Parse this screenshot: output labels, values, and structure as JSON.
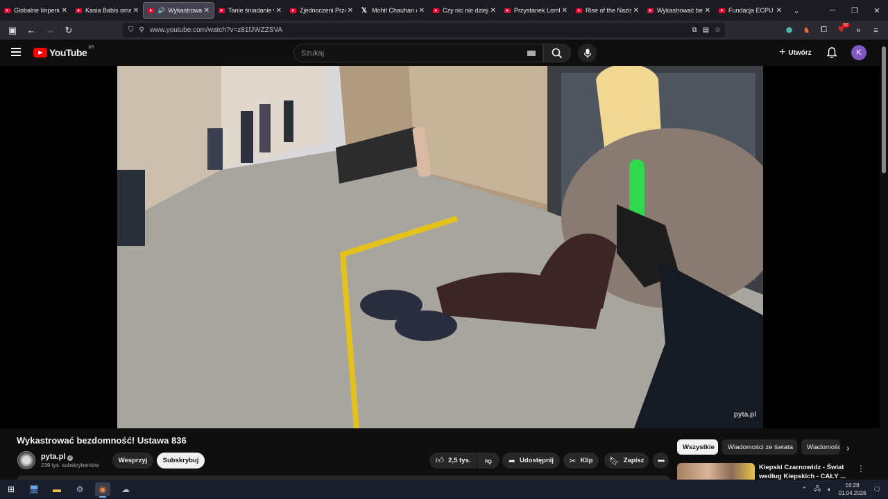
{
  "browser": {
    "tabs": [
      {
        "label": "Globalne Imperium",
        "icon": "youtube-icon",
        "active": false
      },
      {
        "label": "Kasia Babis omaw",
        "icon": "youtube-icon",
        "active": false
      },
      {
        "label": "Wykastrować",
        "icon": "youtube-icon",
        "active": true,
        "audio": true
      },
      {
        "label": "Tanie śniadanie w",
        "icon": "youtube-icon",
        "active": false
      },
      {
        "label": "Zjednoczeni Przec",
        "icon": "youtube-icon",
        "active": false
      },
      {
        "label": "Mohit Chauhan on",
        "icon": "x-icon",
        "active": false
      },
      {
        "label": "Czy nic nie dzieje",
        "icon": "youtube-icon",
        "active": false
      },
      {
        "label": "Przystanek Lomba",
        "icon": "youtube-icon",
        "active": false
      },
      {
        "label": "Rise of the Nazis a",
        "icon": "youtube-icon",
        "active": false
      },
      {
        "label": "Wykastrować bez",
        "icon": "youtube-icon",
        "active": false
      },
      {
        "label": "Fundacja ECPU Po",
        "icon": "youtube-icon",
        "active": false
      }
    ],
    "url": "www.youtube.com/watch?v=z81fJWZZSVA",
    "extension_badge": "32"
  },
  "masthead": {
    "logo_text": "YouTube",
    "country_code": "BR",
    "search_placeholder": "Szukaj",
    "create_label": "Utwórz",
    "avatar_letter": "K"
  },
  "video": {
    "watermark": "pyta.pl",
    "title": "Wykastrować bezdomność! Ustawa 836"
  },
  "channel": {
    "name": "pyta.pl",
    "subscribers": "239 tys. subskrybentów",
    "support_label": "Wesprzyj",
    "subscribe_label": "Subskrybuj"
  },
  "actions": {
    "likes": "2,5 tys.",
    "share_label": "Udostępnij",
    "clip_label": "Klip",
    "save_label": "Zapisz"
  },
  "sidebar": {
    "chips": [
      "Wszystkie",
      "Wiadomości ze świata",
      "Wiadomości"
    ],
    "recommended": [
      {
        "title": "Kiepski Czarnowidz - Świat według Kiepskich - CAŁY ..."
      }
    ]
  },
  "taskbar": {
    "time": "16:28",
    "date": "01.04.2026"
  }
}
